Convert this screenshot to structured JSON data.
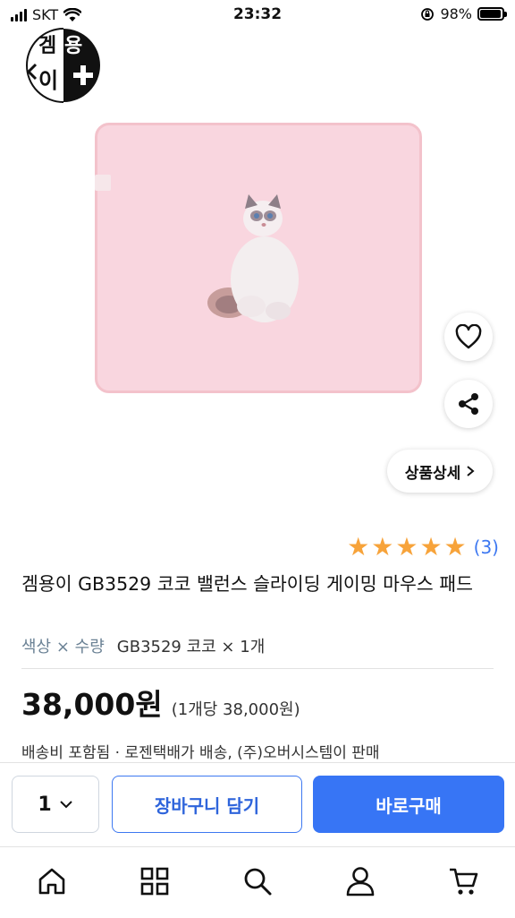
{
  "status_bar": {
    "carrier": "SKT",
    "time": "23:32",
    "battery": "98%"
  },
  "brand": {
    "logo_text_top": "겜용",
    "logo_text_bottom": "이"
  },
  "product": {
    "detail_button_label": "상품상세",
    "rating_stars": 5,
    "review_count": "(3)",
    "title": "겜용이 GB3529 코코 밸런스 슬라이딩 게이밍 마우스 패드",
    "option_label": "색상 × 수량",
    "option_value": "GB3529 코코 × 1개",
    "price": "38,000원",
    "unit_price": "(1개당 38,000원)",
    "shipping": "배송비 포함됨 ·  로젠택배가 배송, (주)오버시스템이 판매"
  },
  "actions": {
    "quantity": "1",
    "cart_label": "장바구니 담기",
    "buy_label": "바로구매"
  },
  "colors": {
    "accent": "#3775f5",
    "star": "#f7a33a",
    "mat": "#f9d6df"
  },
  "nav": [
    "home-icon",
    "categories-icon",
    "search-icon",
    "user-icon",
    "cart-icon"
  ]
}
